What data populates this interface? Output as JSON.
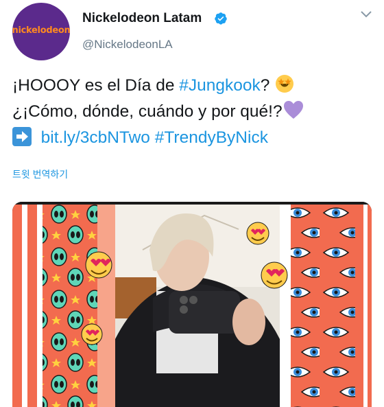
{
  "account": {
    "display_name": "Nickelodeon Latam",
    "handle": "@NickelodeonLA",
    "avatar_text": "nickelodeon",
    "verified_icon": "verified-badge-icon",
    "menu_icon": "chevron-down-icon"
  },
  "tweet": {
    "line1_text": "¡HOOOY es el Día de ",
    "line1_hashtag": "#Jungkook",
    "line1_suffix": "? ",
    "line1_emoji": "star-struck-emoji",
    "line2_text": "¿¡Cómo, dónde, cuándo y por qué!?",
    "line2_emoji": "purple-heart-emoji",
    "line3_icon": "right-arrow-emoji",
    "line3_link": "bit.ly/3cbNTwo",
    "line3_hashtag": "#TrendyByNick"
  },
  "translate_label": "트윗 번역하기",
  "media": {
    "type": "photo",
    "description_icons": [
      "alien-sticker",
      "heart-eyes-emoji-sticker",
      "eye-sticker",
      "star-sticker"
    ]
  },
  "colors": {
    "link": "#1b95e0",
    "avatar_bg": "#5b2a8c",
    "avatar_logo": "#ff8a1f",
    "panel_orange": "#f26b4f",
    "secondary_text": "#657786"
  }
}
